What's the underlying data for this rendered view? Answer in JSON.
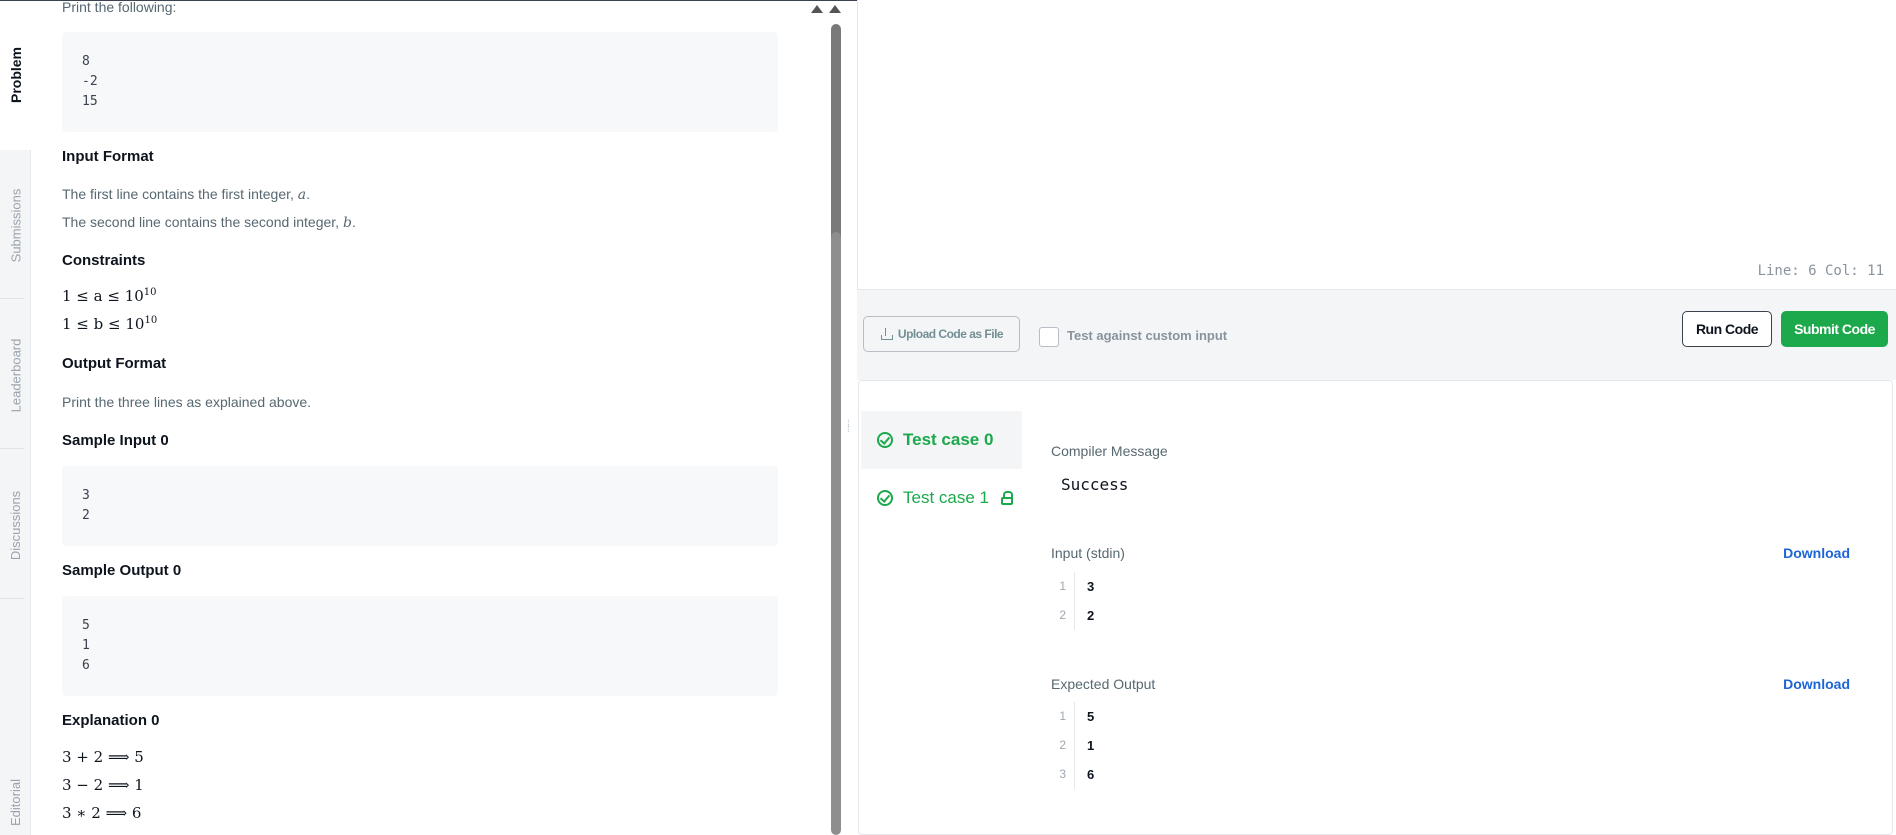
{
  "rail": {
    "tabs": [
      "Problem",
      "Submissions",
      "Leaderboard",
      "Discussions",
      "Editorial"
    ]
  },
  "problem": {
    "print_following": "Print the following:",
    "print_block": [
      "8",
      "-2",
      "15"
    ],
    "input_format_heading": "Input Format",
    "input_line1_text": "The first line contains the first integer, ",
    "input_line1_var": "a",
    "input_line2_text": "The second line contains the second integer, ",
    "input_line2_var": "b",
    "constraints_heading": "Constraints",
    "constraint_a": "1 ≤ a ≤ 10",
    "constraint_b": "1 ≤ b ≤ 10",
    "constraint_exp": "10",
    "output_format_heading": "Output Format",
    "output_format_text": "Print the three lines as explained above.",
    "sample_input_heading": "Sample Input 0",
    "sample_input": [
      "3",
      "2"
    ],
    "sample_output_heading": "Sample Output 0",
    "sample_output": [
      "5",
      "1",
      "6"
    ],
    "explanation_heading": "Explanation 0",
    "explanation": [
      "3 + 2  ⟹  5",
      "3 − 2  ⟹  1",
      "3 ∗ 2  ⟹  6"
    ]
  },
  "editor": {
    "status": "Line: 6 Col: 11"
  },
  "toolbar": {
    "upload_label": "Upload Code as File",
    "custom_input_label": "Test against custom input",
    "run_label": "Run Code",
    "submit_label": "Submit Code"
  },
  "results": {
    "tabs": [
      {
        "label": "Test case 0",
        "active": true,
        "locked": false
      },
      {
        "label": "Test case 1",
        "active": false,
        "locked": true
      }
    ],
    "compiler_message_label": "Compiler Message",
    "compiler_message": "Success",
    "input_label": "Input (stdin)",
    "input_download": "Download",
    "input_lines": [
      {
        "n": "1",
        "v": "3"
      },
      {
        "n": "2",
        "v": "2"
      }
    ],
    "expected_label": "Expected Output",
    "expected_download": "Download",
    "expected_lines": [
      {
        "n": "1",
        "v": "5"
      },
      {
        "n": "2",
        "v": "1"
      },
      {
        "n": "3",
        "v": "6"
      }
    ]
  },
  "colors": {
    "accent_green": "#1ba94c",
    "link_blue": "#1c65d6"
  }
}
